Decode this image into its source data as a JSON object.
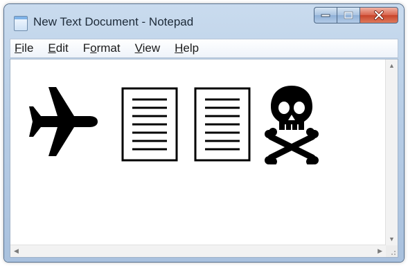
{
  "window": {
    "title": "New Text Document - Notepad",
    "icon": "notepad-icon"
  },
  "menu": [
    {
      "label": "File",
      "accel": "F",
      "rest": "ile"
    },
    {
      "label": "Edit",
      "accel": "E",
      "rest": "dit"
    },
    {
      "label": "Format",
      "pre": "F",
      "accel": "o",
      "rest": "rmat"
    },
    {
      "label": "View",
      "accel": "V",
      "rest": "iew"
    },
    {
      "label": "Help",
      "accel": "H",
      "rest": "elp"
    }
  ],
  "document": {
    "glyphs": [
      "airplane-icon",
      "document-icon",
      "document-icon",
      "skull-crossbones-icon"
    ]
  }
}
